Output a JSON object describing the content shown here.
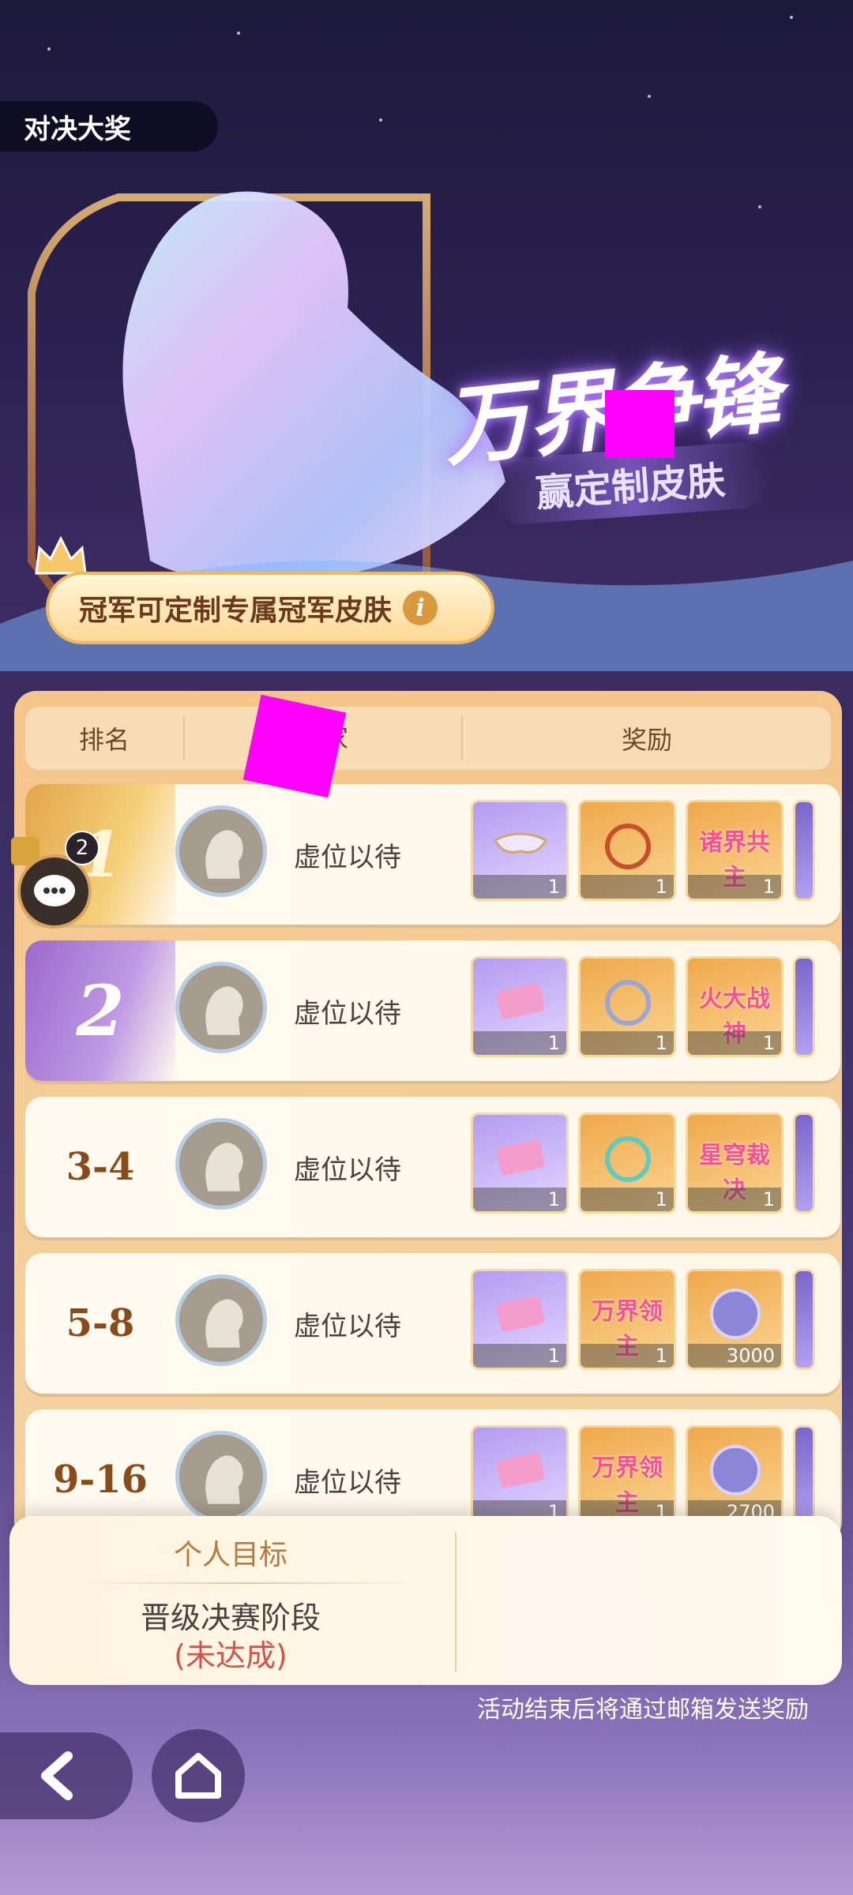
{
  "header": {
    "title": "对决大奖"
  },
  "banner": {
    "headline": "万界争锋",
    "subtitle": "赢定制皮肤",
    "champion_note": "冠军可定制专属冠军皮肤"
  },
  "table": {
    "columns": {
      "rank": "排名",
      "player": "玩家",
      "reward": "奖励"
    },
    "rows": [
      {
        "rank": "1",
        "player": "虚位以待",
        "rewards": [
          {
            "type": "mask",
            "qty": "1"
          },
          {
            "type": "1st-frame",
            "qty": "1"
          },
          {
            "type": "诸界共主",
            "qty": "1"
          }
        ]
      },
      {
        "rank": "2",
        "player": "虚位以待",
        "rewards": [
          {
            "type": "ticket",
            "qty": "1"
          },
          {
            "type": "2nd-frame",
            "qty": "1"
          },
          {
            "type": "火大战神",
            "qty": "1"
          }
        ]
      },
      {
        "rank": "3-4",
        "player": "虚位以待",
        "rewards": [
          {
            "type": "ticket",
            "qty": "1"
          },
          {
            "type": "3rd-frame",
            "qty": "1"
          },
          {
            "type": "星穹裁决",
            "qty": "1"
          }
        ]
      },
      {
        "rank": "5-8",
        "player": "虚位以待",
        "rewards": [
          {
            "type": "ticket",
            "qty": "1"
          },
          {
            "type": "万界领主",
            "qty": "1"
          },
          {
            "type": "coin",
            "qty": "3000"
          }
        ]
      },
      {
        "rank": "9-16",
        "player": "虚位以待",
        "rewards": [
          {
            "type": "ticket",
            "qty": "1"
          },
          {
            "type": "万界领主",
            "qty": "1"
          },
          {
            "type": "coin",
            "qty": "2700"
          }
        ]
      }
    ]
  },
  "chat": {
    "badge": "2"
  },
  "personal_target": {
    "title": "个人目标",
    "goal": "晋级决赛阶段",
    "status": "(未达成)"
  },
  "mail_note": "活动结束后将通过邮箱发送奖励",
  "icons": {
    "back": "back-arrow-icon",
    "home": "home-icon",
    "info": "info-icon",
    "chat": "chat-icon",
    "crown": "crown-icon"
  }
}
